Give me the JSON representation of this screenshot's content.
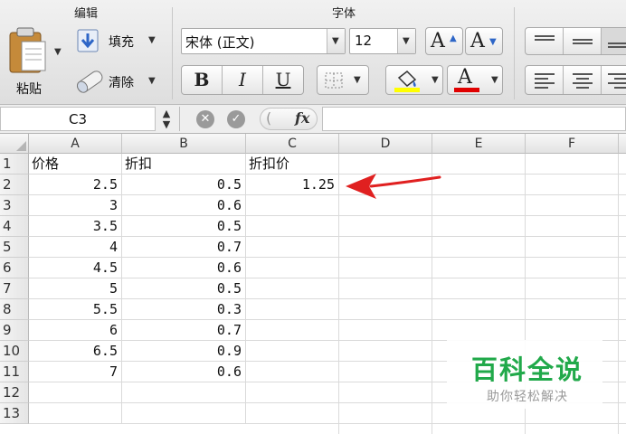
{
  "ribbon": {
    "edit_group": {
      "title": "编辑",
      "paste_label": "粘贴",
      "fill_label": "填充",
      "clear_label": "清除"
    },
    "font_group": {
      "title": "字体",
      "font_name": "宋体 (正文)",
      "font_size": "12",
      "increase_font_glyph": "A",
      "decrease_font_glyph": "A",
      "bold": "B",
      "italic": "I",
      "underline": "U",
      "font_color_glyph": "A"
    },
    "colors": {
      "highlight": "#ffff00",
      "font_color": "#e00000"
    }
  },
  "formula_bar": {
    "name_box": "C3",
    "fx": "fx",
    "content": ""
  },
  "sheet": {
    "columns": [
      "A",
      "B",
      "C",
      "D",
      "E",
      "F"
    ],
    "rows": [
      "1",
      "2",
      "3",
      "4",
      "5",
      "6",
      "7",
      "8",
      "9",
      "10",
      "11",
      "12",
      "13"
    ],
    "headers": [
      "价格",
      "折扣",
      "折扣价"
    ],
    "data": [
      [
        "2.5",
        "0.5",
        "1.25"
      ],
      [
        "3",
        "0.6",
        ""
      ],
      [
        "3.5",
        "0.5",
        ""
      ],
      [
        "4",
        "0.7",
        ""
      ],
      [
        "4.5",
        "0.6",
        ""
      ],
      [
        "5",
        "0.5",
        ""
      ],
      [
        "5.5",
        "0.3",
        ""
      ],
      [
        "6",
        "0.7",
        ""
      ],
      [
        "6.5",
        "0.9",
        ""
      ],
      [
        "7",
        "0.6",
        ""
      ]
    ],
    "selected_cell": "C3"
  },
  "annotation": {
    "arrow_color": "#e02020"
  },
  "watermark": {
    "title": "百科全说",
    "subtitle": "助你轻松解决"
  }
}
